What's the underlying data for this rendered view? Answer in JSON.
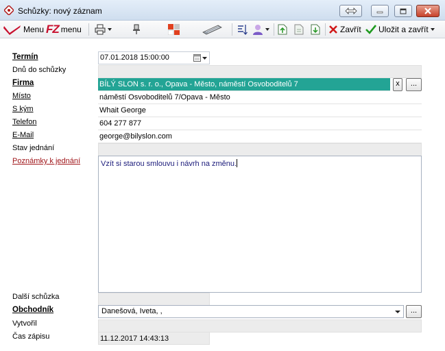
{
  "window": {
    "title": "Schůzky: nový záznam"
  },
  "toolbar": {
    "menu1_label": "Menu",
    "menu2_label": "menu",
    "fz_logo": "FZ",
    "close_label": "Zavřít",
    "save_close_label": "Uložit a zavřít"
  },
  "form": {
    "labels": {
      "termin": "Termín",
      "dnu": "Dnů do schůzky",
      "firma": "Firma",
      "misto": "Místo",
      "skym": "S kým",
      "telefon": "Telefon",
      "email": "E-Mail",
      "stav": "Stav jednání",
      "poznamky": "Poznámky k jednání",
      "dalsi": "Další schůzka",
      "obchodnik": "Obchodník",
      "vytvoril": "Vytvořil",
      "cas": "Čas zápisu"
    },
    "values": {
      "termin": "07.01.2018 15:00:00",
      "dnu": "",
      "firma": "BÍLÝ  SLON s. r. o., Opava - Město, náměstí Osvoboditelů 7",
      "misto": "náměstí Osvoboditelů 7/Opava - Město",
      "skym": "Whait George",
      "telefon": "604 277 877",
      "email": "george@bilyslon.com",
      "stav": "",
      "poznamky": "Vzít si starou smlouvu i návrh na  změnu.",
      "dalsi": "",
      "obchodnik": "Danešová, Iveta, ,",
      "vytvoril": "",
      "cas": "11.12.2017 14:43:13"
    },
    "firma_clear_label": "x",
    "ellipsis_label": "..."
  },
  "colors": {
    "highlight": "#23a495",
    "label_red": "#a0161a",
    "menu_red": "#c8102e"
  }
}
